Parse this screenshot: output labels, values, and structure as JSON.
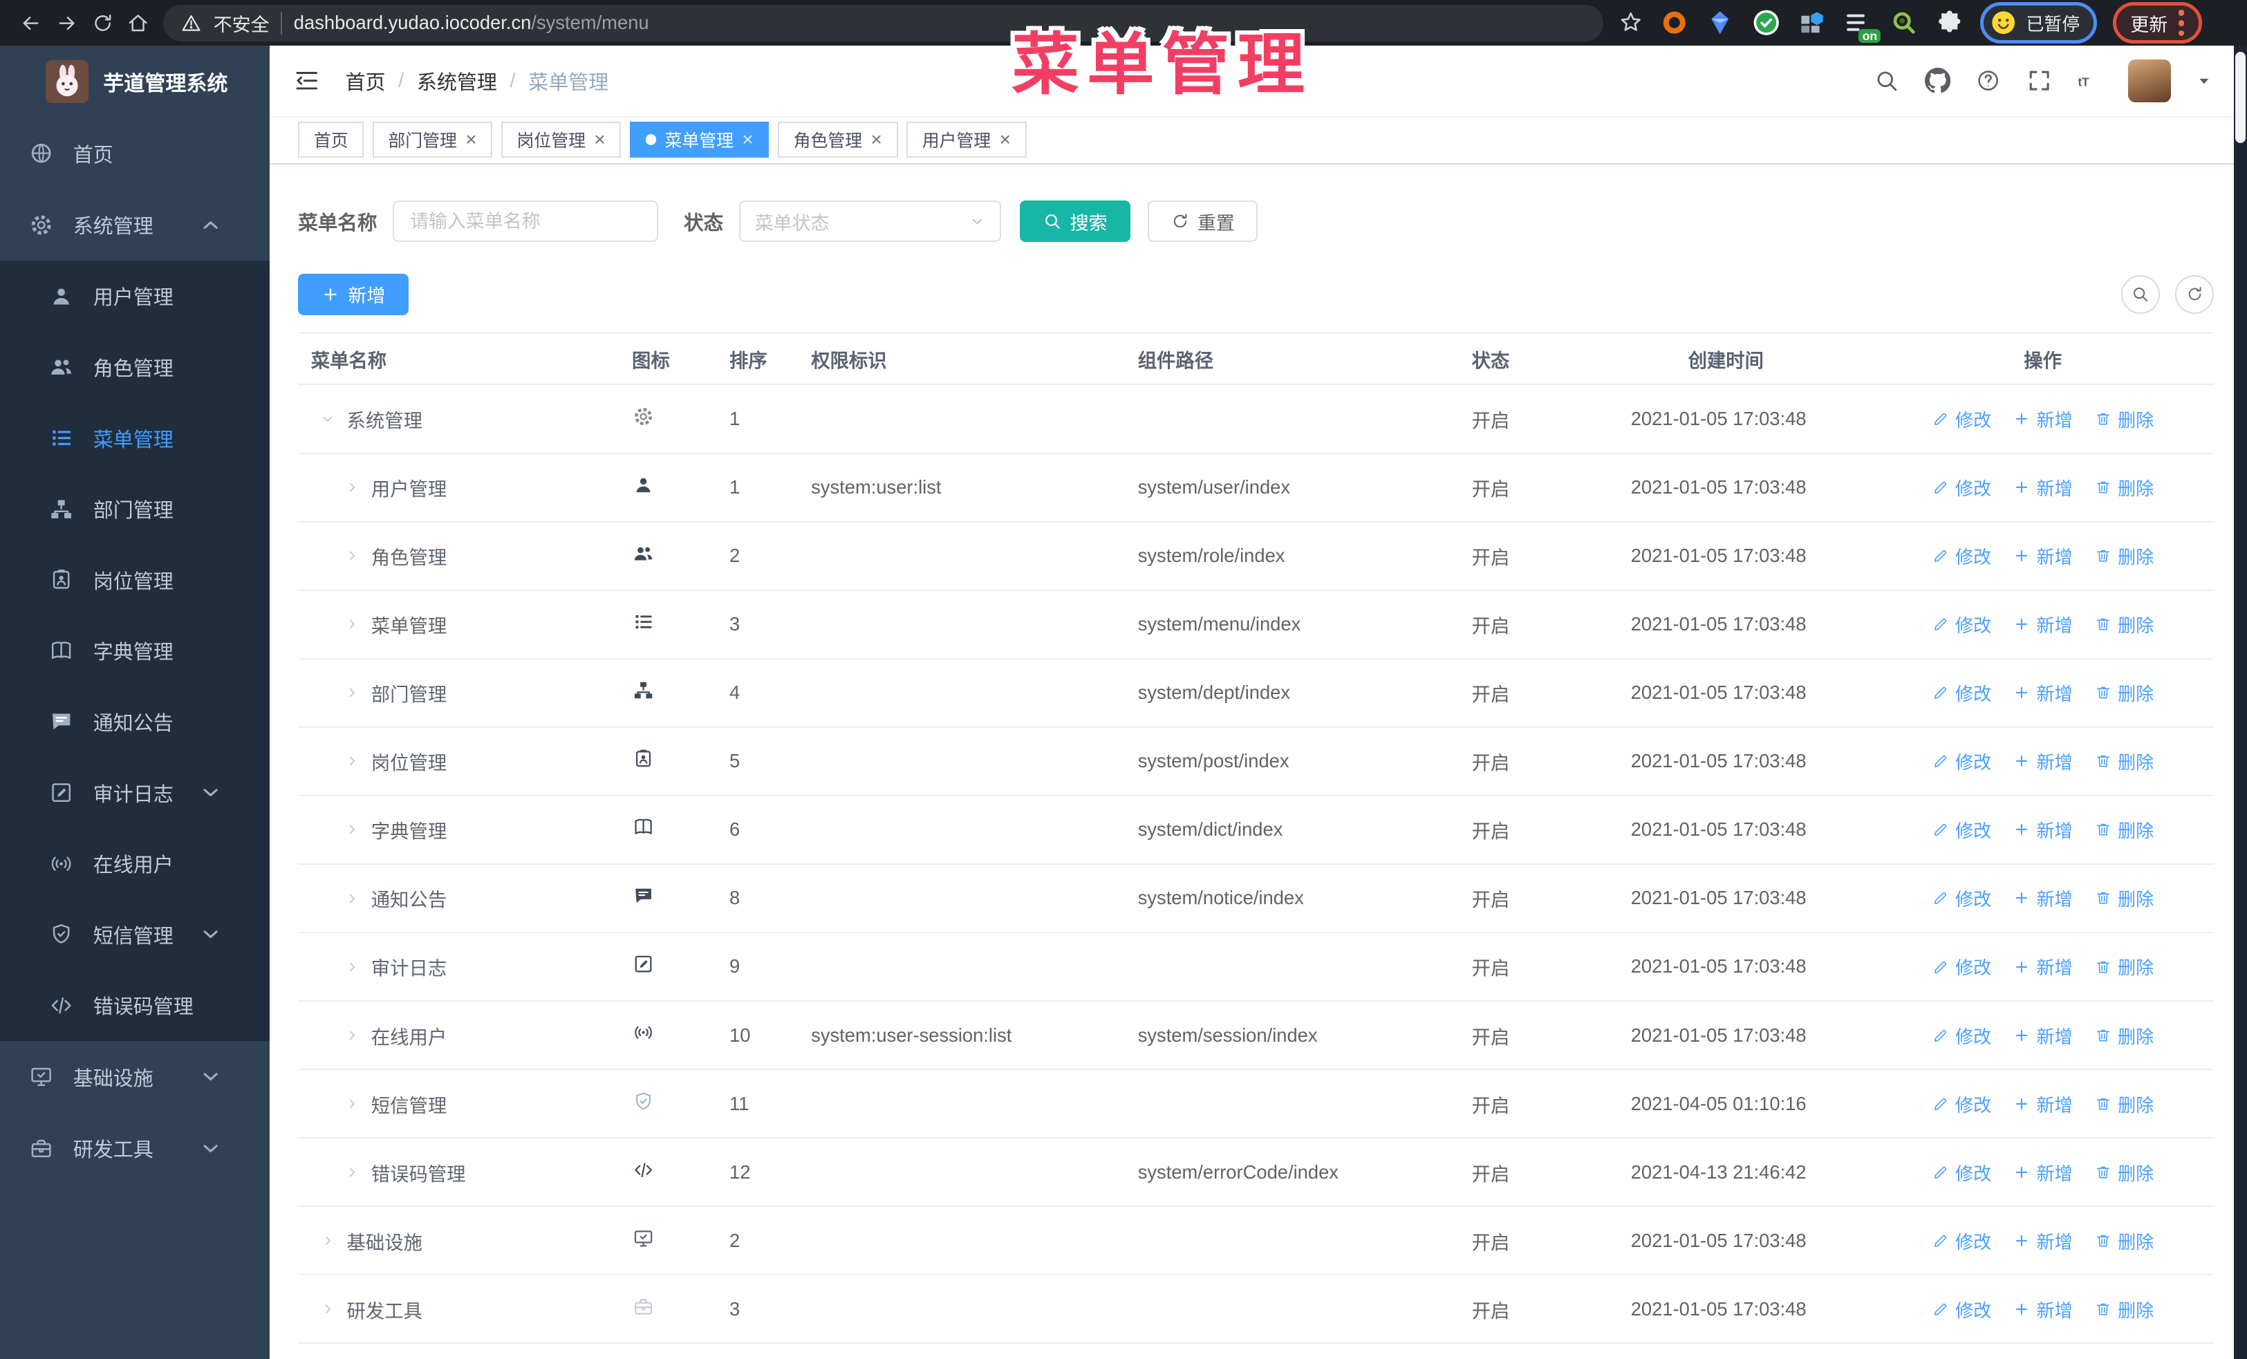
{
  "colors": {
    "primary": "#409eff",
    "search_teal": "#18b7a5",
    "overlay_pink": "#f33e63",
    "sidebar_bg": "#304156",
    "submenu_bg": "#1f2d3d",
    "status_open": "#606266"
  },
  "overlay_title": "菜单管理",
  "browser": {
    "security_label": "不安全",
    "url_host": "dashboard.yudao.iocoder.cn",
    "url_path": "/system/menu",
    "extension_on_badge": "on",
    "profile_status_label": "已暂停",
    "update_label": "更新"
  },
  "sidebar": {
    "app_title": "芋道管理系统",
    "menu": [
      {
        "label": "首页",
        "icon": "dashboard-icon",
        "type": "root"
      },
      {
        "label": "系统管理",
        "icon": "gear-icon",
        "type": "root",
        "chevron": "up"
      },
      {
        "label": "用户管理",
        "icon": "user-icon",
        "type": "sub"
      },
      {
        "label": "角色管理",
        "icon": "users-icon",
        "type": "sub"
      },
      {
        "label": "菜单管理",
        "icon": "menu-icon",
        "type": "sub",
        "active": true
      },
      {
        "label": "部门管理",
        "icon": "org-tree-icon",
        "type": "sub"
      },
      {
        "label": "岗位管理",
        "icon": "id-badge-icon",
        "type": "sub"
      },
      {
        "label": "字典管理",
        "icon": "dict-icon",
        "type": "sub"
      },
      {
        "label": "通知公告",
        "icon": "notice-icon",
        "type": "sub"
      },
      {
        "label": "审计日志",
        "icon": "audit-icon",
        "type": "sub",
        "chevron": "down"
      },
      {
        "label": "在线用户",
        "icon": "online-icon",
        "type": "sub"
      },
      {
        "label": "短信管理",
        "icon": "sms-icon",
        "type": "sub",
        "chevron": "down"
      },
      {
        "label": "错误码管理",
        "icon": "code-icon",
        "type": "sub"
      },
      {
        "label": "基础设施",
        "icon": "monitor-icon",
        "type": "root",
        "chevron": "down"
      },
      {
        "label": "研发工具",
        "icon": "toolbox-icon",
        "type": "root",
        "chevron": "down"
      }
    ]
  },
  "breadcrumb": {
    "separator": "/",
    "items": [
      "首页",
      "系统管理",
      "菜单管理"
    ]
  },
  "tabs": [
    {
      "label": "首页",
      "closable": false,
      "active": false
    },
    {
      "label": "部门管理",
      "closable": true,
      "active": false
    },
    {
      "label": "岗位管理",
      "closable": true,
      "active": false
    },
    {
      "label": "菜单管理",
      "closable": true,
      "active": true
    },
    {
      "label": "角色管理",
      "closable": true,
      "active": false
    },
    {
      "label": "用户管理",
      "closable": true,
      "active": false
    }
  ],
  "filters": {
    "name_label": "菜单名称",
    "name_placeholder": "请输入菜单名称",
    "status_label": "状态",
    "status_placeholder": "菜单状态",
    "search_label": "搜索",
    "reset_label": "重置"
  },
  "toolbar": {
    "add_label": "新增"
  },
  "table": {
    "columns": [
      "菜单名称",
      "图标",
      "排序",
      "权限标识",
      "组件路径",
      "状态",
      "创建时间",
      "操作"
    ],
    "actions": {
      "edit": "修改",
      "add": "新增",
      "delete": "删除"
    },
    "rows": [
      {
        "name": "系统管理",
        "icon": "gear-icon",
        "caret": "down",
        "level": 0,
        "sort": "1",
        "perm": "",
        "path": "",
        "status": "开启",
        "time": "2021-01-05 17:03:48"
      },
      {
        "name": "用户管理",
        "icon": "user-icon",
        "caret": "right",
        "level": 1,
        "sort": "1",
        "perm": "system:user:list",
        "path": "system/user/index",
        "status": "开启",
        "time": "2021-01-05 17:03:48"
      },
      {
        "name": "角色管理",
        "icon": "users-icon",
        "caret": "right",
        "level": 1,
        "sort": "2",
        "perm": "",
        "path": "system/role/index",
        "status": "开启",
        "time": "2021-01-05 17:03:48"
      },
      {
        "name": "菜单管理",
        "icon": "menu-icon",
        "caret": "right",
        "level": 1,
        "sort": "3",
        "perm": "",
        "path": "system/menu/index",
        "status": "开启",
        "time": "2021-01-05 17:03:48"
      },
      {
        "name": "部门管理",
        "icon": "org-tree-icon",
        "caret": "right",
        "level": 1,
        "sort": "4",
        "perm": "",
        "path": "system/dept/index",
        "status": "开启",
        "time": "2021-01-05 17:03:48"
      },
      {
        "name": "岗位管理",
        "icon": "id-badge-icon",
        "caret": "right",
        "level": 1,
        "sort": "5",
        "perm": "",
        "path": "system/post/index",
        "status": "开启",
        "time": "2021-01-05 17:03:48"
      },
      {
        "name": "字典管理",
        "icon": "dict-icon",
        "caret": "right",
        "level": 1,
        "sort": "6",
        "perm": "",
        "path": "system/dict/index",
        "status": "开启",
        "time": "2021-01-05 17:03:48"
      },
      {
        "name": "通知公告",
        "icon": "notice-icon",
        "caret": "right",
        "level": 1,
        "sort": "8",
        "perm": "",
        "path": "system/notice/index",
        "status": "开启",
        "time": "2021-01-05 17:03:48"
      },
      {
        "name": "审计日志",
        "icon": "audit-icon",
        "caret": "right",
        "level": 1,
        "sort": "9",
        "perm": "",
        "path": "",
        "status": "开启",
        "time": "2021-01-05 17:03:48"
      },
      {
        "name": "在线用户",
        "icon": "online-icon",
        "caret": "right",
        "level": 1,
        "sort": "10",
        "perm": "system:user-session:list",
        "path": "system/session/index",
        "status": "开启",
        "time": "2021-01-05 17:03:48"
      },
      {
        "name": "短信管理",
        "icon": "sms-icon",
        "caret": "right",
        "level": 1,
        "sort": "11",
        "perm": "",
        "path": "",
        "status": "开启",
        "time": "2021-04-05 01:10:16"
      },
      {
        "name": "错误码管理",
        "icon": "code-icon",
        "caret": "right",
        "level": 1,
        "sort": "12",
        "perm": "",
        "path": "system/errorCode/index",
        "status": "开启",
        "time": "2021-04-13 21:46:42"
      },
      {
        "name": "基础设施",
        "icon": "monitor-icon",
        "caret": "right",
        "level": 0,
        "sort": "2",
        "perm": "",
        "path": "",
        "status": "开启",
        "time": "2021-01-05 17:03:48"
      },
      {
        "name": "研发工具",
        "icon": "toolbox-icon",
        "caret": "right",
        "level": 0,
        "sort": "3",
        "perm": "",
        "path": "",
        "status": "开启",
        "time": "2021-01-05 17:03:48"
      }
    ]
  }
}
